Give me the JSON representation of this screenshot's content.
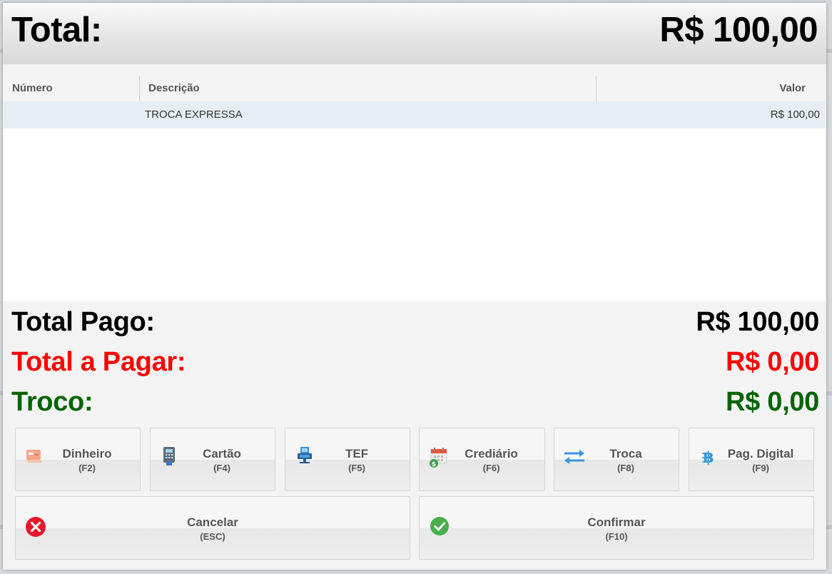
{
  "header": {
    "label": "Total:",
    "value": "R$ 100,00"
  },
  "grid": {
    "columns": [
      "Número",
      "Descrição",
      "Valor"
    ],
    "rows": [
      {
        "numero": "",
        "descricao": "TROCA EXPRESSA",
        "valor": "R$ 100,00"
      }
    ]
  },
  "totals": {
    "pago_label": "Total Pago:",
    "pago_value": "R$ 100,00",
    "apagar_label": "Total a Pagar:",
    "apagar_value": "R$ 0,00",
    "troco_label": "Troco:",
    "troco_value": "R$ 0,00"
  },
  "colors": {
    "black": "#000000",
    "red": "#ff0000",
    "green": "#006400",
    "header_bg": "#e0e0e0"
  },
  "buttons": [
    {
      "label": "Dinheiro",
      "key": "(F2)",
      "icon": "cash-icon"
    },
    {
      "label": "Cartão",
      "key": "(F4)",
      "icon": "card-machine-icon"
    },
    {
      "label": "TEF",
      "key": "(F5)",
      "icon": "tef-terminal-icon"
    },
    {
      "label": "Crediário",
      "key": "(F6)",
      "icon": "calendar-money-icon"
    },
    {
      "label": "Troca",
      "key": "(F8)",
      "icon": "exchange-arrows-icon"
    },
    {
      "label": "Pag. Digital",
      "key": "(F9)",
      "icon": "bitcoin-icon"
    }
  ],
  "actions": {
    "cancel": {
      "label": "Cancelar",
      "key": "(ESC)",
      "icon": "cancel-x-icon"
    },
    "confirm": {
      "label": "Confirmar",
      "key": "(F10)",
      "icon": "check-circle-icon"
    }
  }
}
